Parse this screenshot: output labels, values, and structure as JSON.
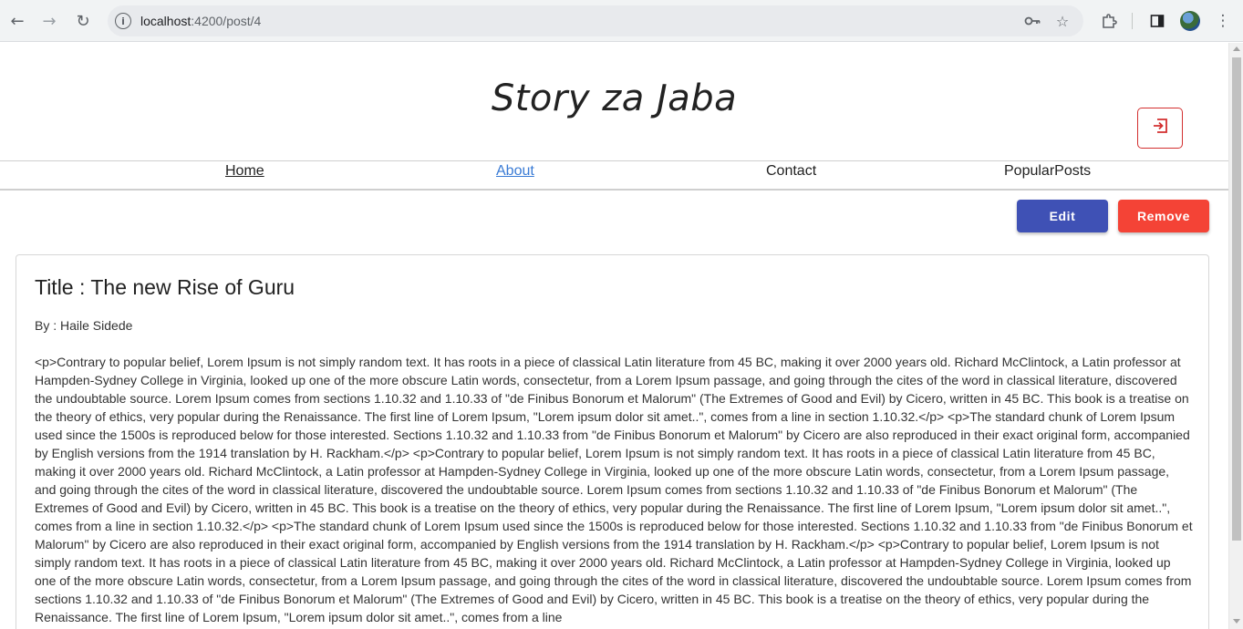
{
  "browser": {
    "url_host": "localhost",
    "url_path": ":4200/post/4",
    "icons": {
      "back": "arrow-left-icon",
      "forward": "arrow-right-icon",
      "reload": "reload-icon",
      "site_info": "info-icon",
      "password": "key-icon",
      "bookmark": "star-icon",
      "extensions": "puzzle-icon",
      "side_panel": "side-panel-icon",
      "profile": "avatar",
      "menu": "kebab-menu-icon"
    }
  },
  "site": {
    "title": "Story za Jaba",
    "login_icon": "login-icon"
  },
  "nav": {
    "items": [
      {
        "label": "Home"
      },
      {
        "label": "About"
      },
      {
        "label": "Contact"
      },
      {
        "label": "PopularPosts"
      }
    ]
  },
  "actions": {
    "edit_label": "Edit",
    "remove_label": "Remove"
  },
  "post": {
    "title": "Title : The new Rise of Guru",
    "author": "By : Haile Sidede",
    "body": "<p>Contrary to popular belief, Lorem Ipsum is not simply random text. It has roots in a piece of classical Latin literature from 45 BC, making it over 2000 years old. Richard McClintock, a Latin professor at Hampden-Sydney College in Virginia, looked up one of the more obscure Latin words, consectetur, from a Lorem Ipsum passage, and going through the cites of the word in classical literature, discovered the undoubtable source. Lorem Ipsum comes from sections 1.10.32 and 1.10.33 of \"de Finibus Bonorum et Malorum\" (The Extremes of Good and Evil) by Cicero, written in 45 BC. This book is a treatise on the theory of ethics, very popular during the Renaissance. The first line of Lorem Ipsum, \"Lorem ipsum dolor sit amet..\", comes from a line in section 1.10.32.</p> <p>The standard chunk of Lorem Ipsum used since the 1500s is reproduced below for those interested. Sections 1.10.32 and 1.10.33 from \"de Finibus Bonorum et Malorum\" by Cicero are also reproduced in their exact original form, accompanied by English versions from the 1914 translation by H. Rackham.</p> <p>Contrary to popular belief, Lorem Ipsum is not simply random text. It has roots in a piece of classical Latin literature from 45 BC, making it over 2000 years old. Richard McClintock, a Latin professor at Hampden-Sydney College in Virginia, looked up one of the more obscure Latin words, consectetur, from a Lorem Ipsum passage, and going through the cites of the word in classical literature, discovered the undoubtable source. Lorem Ipsum comes from sections 1.10.32 and 1.10.33 of \"de Finibus Bonorum et Malorum\" (The Extremes of Good and Evil) by Cicero, written in 45 BC. This book is a treatise on the theory of ethics, very popular during the Renaissance. The first line of Lorem Ipsum, \"Lorem ipsum dolor sit amet..\", comes from a line in section 1.10.32.</p> <p>The standard chunk of Lorem Ipsum used since the 1500s is reproduced below for those interested. Sections 1.10.32 and 1.10.33 from \"de Finibus Bonorum et Malorum\" by Cicero are also reproduced in their exact original form, accompanied by English versions from the 1914 translation by H. Rackham.</p> <p>Contrary to popular belief, Lorem Ipsum is not simply random text. It has roots in a piece of classical Latin literature from 45 BC, making it over 2000 years old. Richard McClintock, a Latin professor at Hampden-Sydney College in Virginia, looked up one of the more obscure Latin words, consectetur, from a Lorem Ipsum passage, and going through the cites of the word in classical literature, discovered the undoubtable source. Lorem Ipsum comes from sections 1.10.32 and 1.10.33 of \"de Finibus Bonorum et Malorum\" (The Extremes of Good and Evil) by Cicero, written in 45 BC. This book is a treatise on the theory of ethics, very popular during the Renaissance. The first line of Lorem Ipsum, \"Lorem ipsum dolor sit amet..\", comes from a line"
  },
  "colors": {
    "edit_button": "#3f51b5",
    "remove_button": "#f44336",
    "login_border": "#d32f2f",
    "active_link": "#3a7bd5"
  }
}
